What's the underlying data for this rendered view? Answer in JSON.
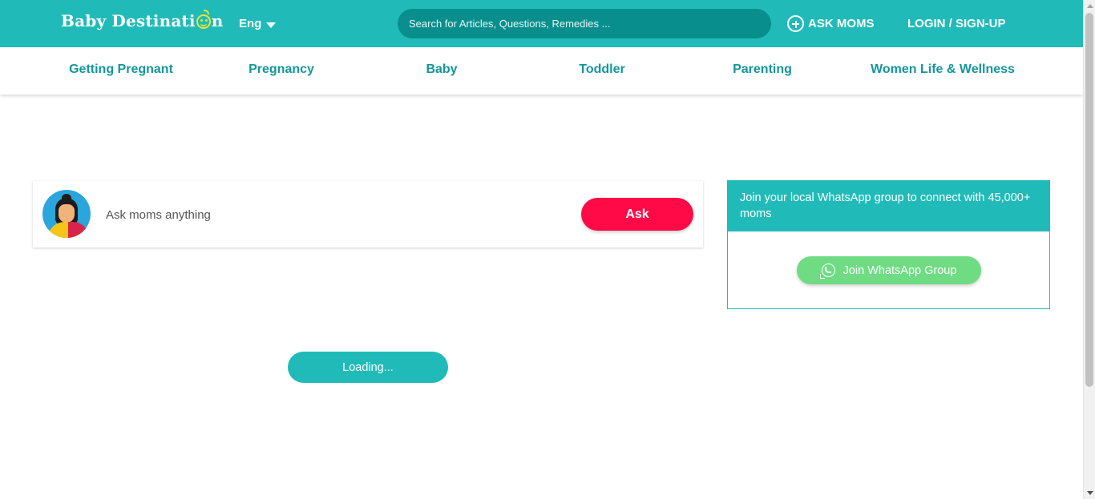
{
  "header": {
    "logo_text_main": "Baby Destinati",
    "logo_text_end": "n",
    "language": "Eng",
    "search_placeholder": "Search for Articles, Questions, Remedies ...",
    "ask_moms": "ASK MOMS",
    "login": "LOGIN / SIGN-UP"
  },
  "categories": [
    "Getting Pregnant",
    "Pregnancy",
    "Baby",
    "Toddler",
    "Parenting",
    "Women Life & Wellness"
  ],
  "ask_card": {
    "placeholder": "Ask moms anything",
    "button": "Ask"
  },
  "whatsapp": {
    "heading": "Join your local WhatsApp group to connect with 45,000+ moms",
    "button": "Join WhatsApp Group",
    "icon": "whatsapp-icon"
  },
  "loading": "Loading...",
  "colors": {
    "brand_teal": "#20bbb9",
    "search_bg": "#088f8d",
    "nav_text": "#14969a",
    "ask_red": "#ff0a46",
    "whatsapp_green": "#6fdc84",
    "logo_yellow": "#e6e633"
  }
}
